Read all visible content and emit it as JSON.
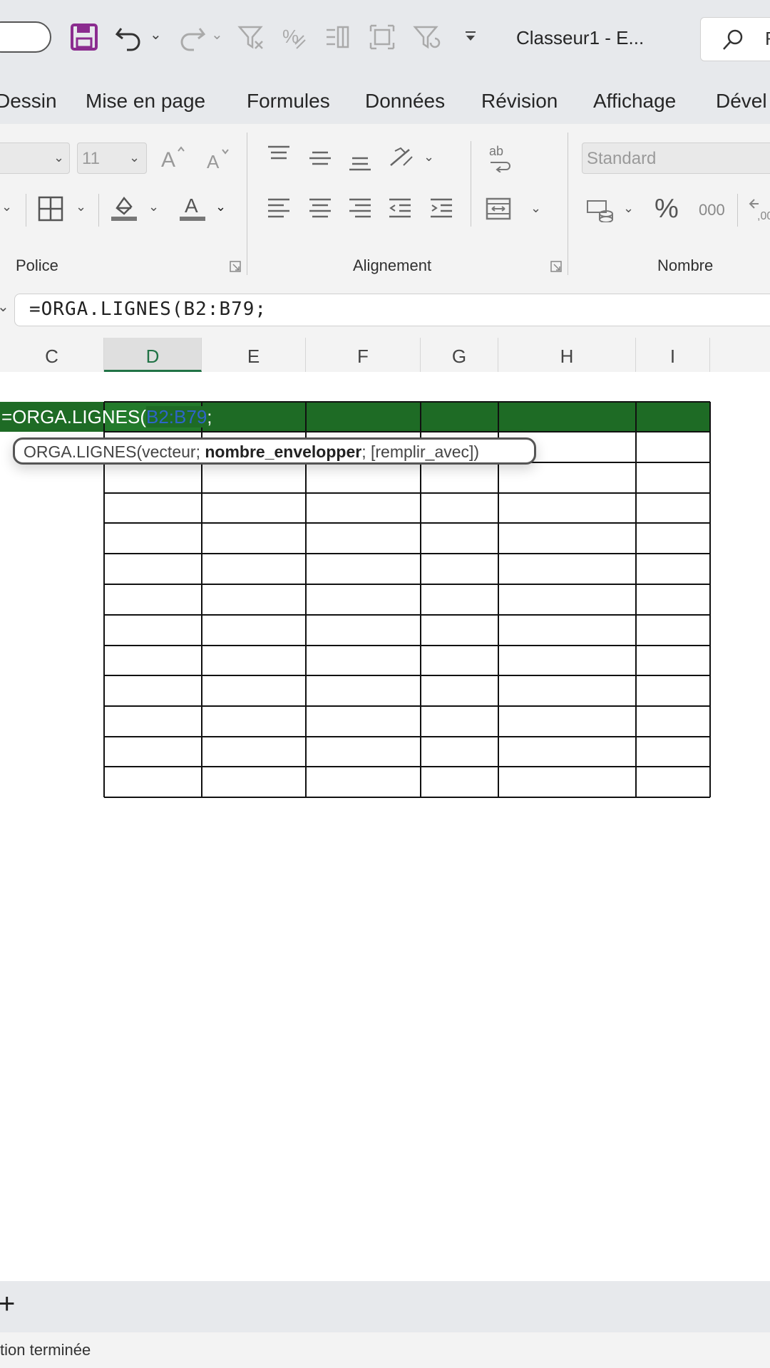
{
  "qat": {
    "title": "Classeur1  -  E...",
    "search_label": "R"
  },
  "menu": {
    "tabs": [
      "Dessin",
      "Mise en page",
      "Formules",
      "Données",
      "Révision",
      "Affichage",
      "Dével"
    ]
  },
  "ribbon": {
    "font_size": "11",
    "number_format": "Standard",
    "percent_symbol": "%",
    "thousands_label": "000",
    "groups": {
      "police": "Police",
      "alignement": "Alignement",
      "nombre": "Nombre"
    }
  },
  "formula_bar": {
    "value": "=ORGA.LIGNES(B2:B79;"
  },
  "columns": [
    "C",
    "D",
    "E",
    "F",
    "G",
    "H",
    "I"
  ],
  "active_column": "D",
  "cell": {
    "prefix": "=ORGA.LIGNES(",
    "reference": "B2:B79",
    "suffix": ";"
  },
  "tooltip": {
    "func": "ORGA.LIGNES(vecteur; ",
    "current_arg": "nombre_envelopper",
    "rest": "; [remplir_avec])"
  },
  "sheet_tabs": {
    "add_symbol": "+"
  },
  "status": {
    "text": "tion terminée"
  },
  "colors": {
    "accent_green": "#217346",
    "header_bg": "#1e6b25",
    "reference_blue": "#2e64c8"
  }
}
